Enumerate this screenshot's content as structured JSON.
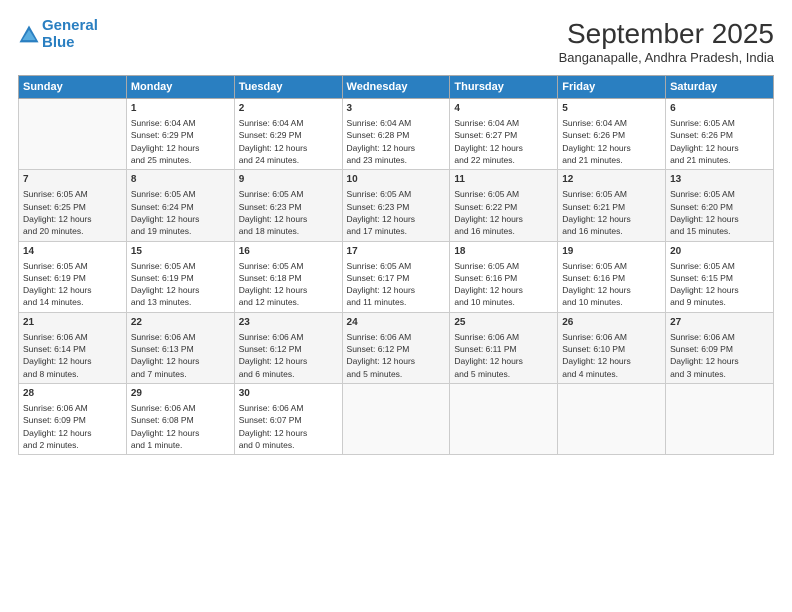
{
  "header": {
    "logo_line1": "General",
    "logo_line2": "Blue",
    "title": "September 2025",
    "subtitle": "Banganapalle, Andhra Pradesh, India"
  },
  "days_of_week": [
    "Sunday",
    "Monday",
    "Tuesday",
    "Wednesday",
    "Thursday",
    "Friday",
    "Saturday"
  ],
  "weeks": [
    [
      {
        "day": "",
        "info": ""
      },
      {
        "day": "1",
        "info": "Sunrise: 6:04 AM\nSunset: 6:29 PM\nDaylight: 12 hours\nand 25 minutes."
      },
      {
        "day": "2",
        "info": "Sunrise: 6:04 AM\nSunset: 6:29 PM\nDaylight: 12 hours\nand 24 minutes."
      },
      {
        "day": "3",
        "info": "Sunrise: 6:04 AM\nSunset: 6:28 PM\nDaylight: 12 hours\nand 23 minutes."
      },
      {
        "day": "4",
        "info": "Sunrise: 6:04 AM\nSunset: 6:27 PM\nDaylight: 12 hours\nand 22 minutes."
      },
      {
        "day": "5",
        "info": "Sunrise: 6:04 AM\nSunset: 6:26 PM\nDaylight: 12 hours\nand 21 minutes."
      },
      {
        "day": "6",
        "info": "Sunrise: 6:05 AM\nSunset: 6:26 PM\nDaylight: 12 hours\nand 21 minutes."
      }
    ],
    [
      {
        "day": "7",
        "info": "Sunrise: 6:05 AM\nSunset: 6:25 PM\nDaylight: 12 hours\nand 20 minutes."
      },
      {
        "day": "8",
        "info": "Sunrise: 6:05 AM\nSunset: 6:24 PM\nDaylight: 12 hours\nand 19 minutes."
      },
      {
        "day": "9",
        "info": "Sunrise: 6:05 AM\nSunset: 6:23 PM\nDaylight: 12 hours\nand 18 minutes."
      },
      {
        "day": "10",
        "info": "Sunrise: 6:05 AM\nSunset: 6:23 PM\nDaylight: 12 hours\nand 17 minutes."
      },
      {
        "day": "11",
        "info": "Sunrise: 6:05 AM\nSunset: 6:22 PM\nDaylight: 12 hours\nand 16 minutes."
      },
      {
        "day": "12",
        "info": "Sunrise: 6:05 AM\nSunset: 6:21 PM\nDaylight: 12 hours\nand 16 minutes."
      },
      {
        "day": "13",
        "info": "Sunrise: 6:05 AM\nSunset: 6:20 PM\nDaylight: 12 hours\nand 15 minutes."
      }
    ],
    [
      {
        "day": "14",
        "info": "Sunrise: 6:05 AM\nSunset: 6:19 PM\nDaylight: 12 hours\nand 14 minutes."
      },
      {
        "day": "15",
        "info": "Sunrise: 6:05 AM\nSunset: 6:19 PM\nDaylight: 12 hours\nand 13 minutes."
      },
      {
        "day": "16",
        "info": "Sunrise: 6:05 AM\nSunset: 6:18 PM\nDaylight: 12 hours\nand 12 minutes."
      },
      {
        "day": "17",
        "info": "Sunrise: 6:05 AM\nSunset: 6:17 PM\nDaylight: 12 hours\nand 11 minutes."
      },
      {
        "day": "18",
        "info": "Sunrise: 6:05 AM\nSunset: 6:16 PM\nDaylight: 12 hours\nand 10 minutes."
      },
      {
        "day": "19",
        "info": "Sunrise: 6:05 AM\nSunset: 6:16 PM\nDaylight: 12 hours\nand 10 minutes."
      },
      {
        "day": "20",
        "info": "Sunrise: 6:05 AM\nSunset: 6:15 PM\nDaylight: 12 hours\nand 9 minutes."
      }
    ],
    [
      {
        "day": "21",
        "info": "Sunrise: 6:06 AM\nSunset: 6:14 PM\nDaylight: 12 hours\nand 8 minutes."
      },
      {
        "day": "22",
        "info": "Sunrise: 6:06 AM\nSunset: 6:13 PM\nDaylight: 12 hours\nand 7 minutes."
      },
      {
        "day": "23",
        "info": "Sunrise: 6:06 AM\nSunset: 6:12 PM\nDaylight: 12 hours\nand 6 minutes."
      },
      {
        "day": "24",
        "info": "Sunrise: 6:06 AM\nSunset: 6:12 PM\nDaylight: 12 hours\nand 5 minutes."
      },
      {
        "day": "25",
        "info": "Sunrise: 6:06 AM\nSunset: 6:11 PM\nDaylight: 12 hours\nand 5 minutes."
      },
      {
        "day": "26",
        "info": "Sunrise: 6:06 AM\nSunset: 6:10 PM\nDaylight: 12 hours\nand 4 minutes."
      },
      {
        "day": "27",
        "info": "Sunrise: 6:06 AM\nSunset: 6:09 PM\nDaylight: 12 hours\nand 3 minutes."
      }
    ],
    [
      {
        "day": "28",
        "info": "Sunrise: 6:06 AM\nSunset: 6:09 PM\nDaylight: 12 hours\nand 2 minutes."
      },
      {
        "day": "29",
        "info": "Sunrise: 6:06 AM\nSunset: 6:08 PM\nDaylight: 12 hours\nand 1 minute."
      },
      {
        "day": "30",
        "info": "Sunrise: 6:06 AM\nSunset: 6:07 PM\nDaylight: 12 hours\nand 0 minutes."
      },
      {
        "day": "",
        "info": ""
      },
      {
        "day": "",
        "info": ""
      },
      {
        "day": "",
        "info": ""
      },
      {
        "day": "",
        "info": ""
      }
    ]
  ]
}
